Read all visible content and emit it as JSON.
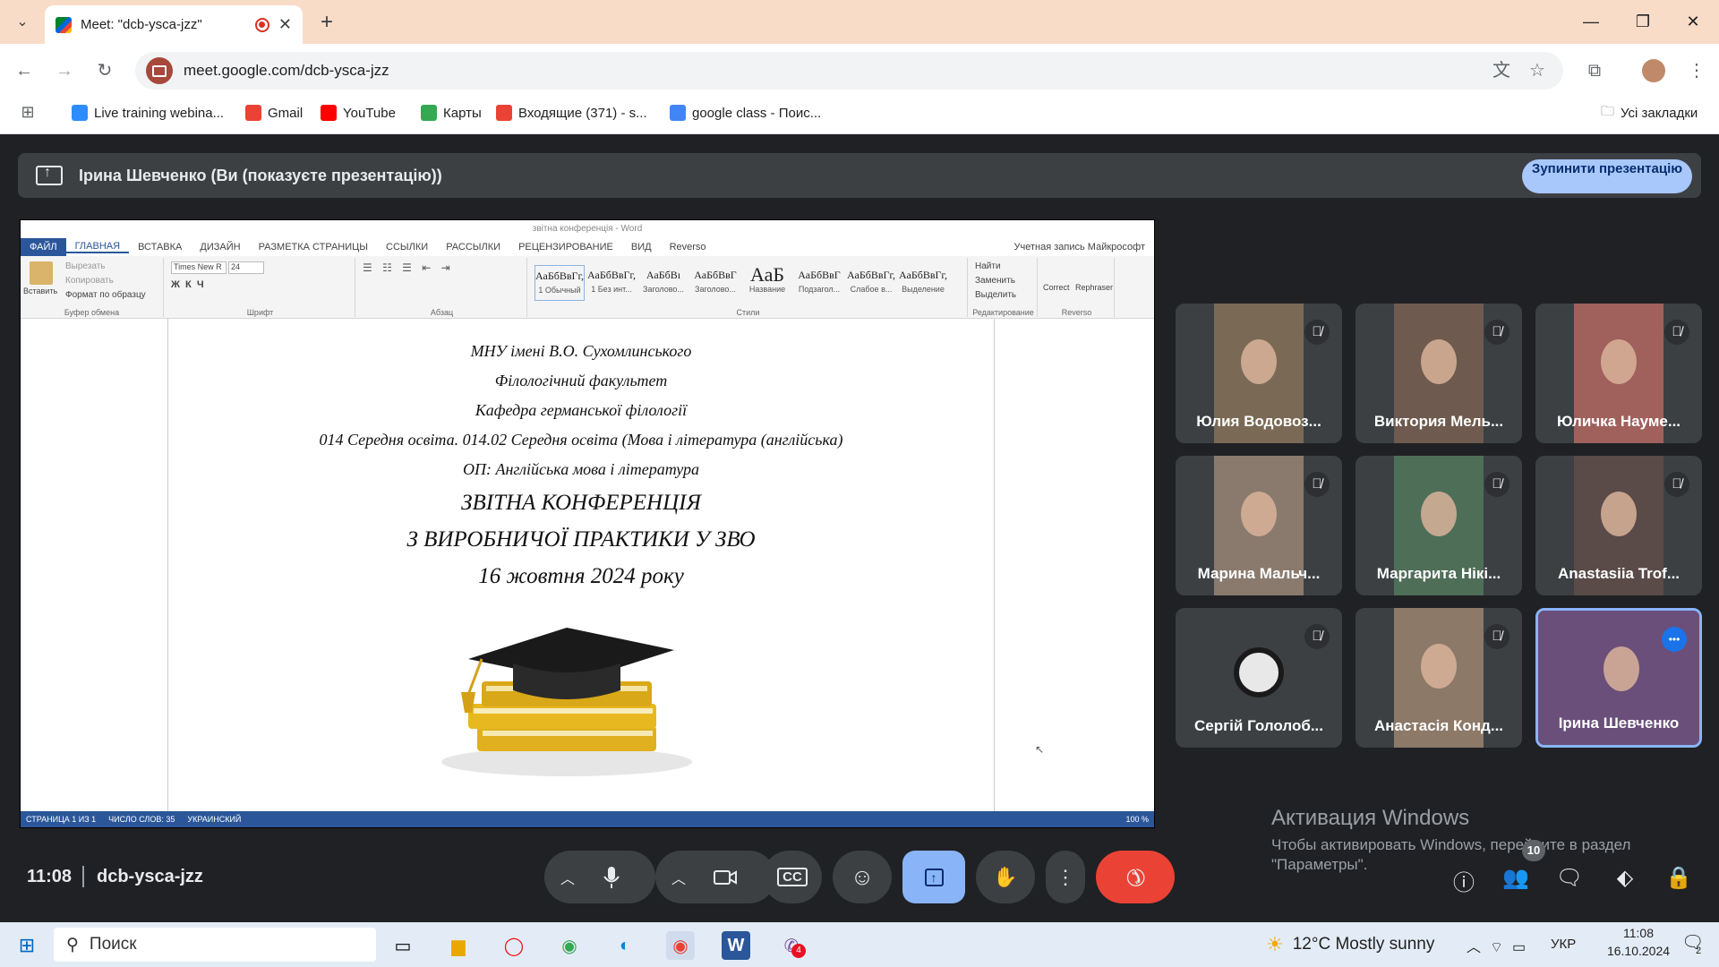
{
  "browser": {
    "tab_title": "Meet: \"dcb-ysca-jzz\"",
    "tab_close": "✕",
    "new_tab": "+",
    "url": "meet.google.com/dcb-ysca-jzz",
    "bookmarks": [
      {
        "label": "Live training webina...",
        "icon": "zoom-icon",
        "color": "#2d8cff"
      },
      {
        "label": "Gmail",
        "icon": "gmail-icon",
        "color": "#ea4335"
      },
      {
        "label": "YouTube",
        "icon": "youtube-icon",
        "color": "#ff0000"
      },
      {
        "label": "Карты",
        "icon": "maps-icon",
        "color": "#34a853"
      },
      {
        "label": "Входящие (371) - s...",
        "icon": "gmail-icon",
        "color": "#ea4335"
      },
      {
        "label": "google class - Поис...",
        "icon": "google-icon",
        "color": "#4285f4"
      }
    ],
    "all_bookmarks": "Усі закладки"
  },
  "presentation_bar": {
    "text": "Ірина Шевченко (Ви (показуєте презентацію))",
    "stop_button": "Зупинити презентацію"
  },
  "word": {
    "title": "звітна конференція - Word",
    "tabs": [
      "ФАЙЛ",
      "ГЛАВНАЯ",
      "ВСТАВКА",
      "ДИЗАЙН",
      "РАЗМЕТКА СТРАНИЦЫ",
      "ССЫЛКИ",
      "РАССЫЛКИ",
      "РЕЦЕНЗИРОВАНИЕ",
      "ВИД",
      "Reverso"
    ],
    "account": "Учетная запись Майкрософт",
    "clipboard": {
      "paste": "Вставить",
      "cut": "Вырезать",
      "copy": "Копировать",
      "format": "Формат по образцу",
      "label": "Буфер обмена"
    },
    "font": {
      "name": "Times New R",
      "size": "24",
      "label": "Шрифт"
    },
    "paragraph_label": "Абзац",
    "styles": [
      {
        "sample": "АаБбВвГг,",
        "name": "1 Обычный"
      },
      {
        "sample": "АаБбВвГг,",
        "name": "1 Без инт..."
      },
      {
        "sample": "АаБбВı",
        "name": "Заголово..."
      },
      {
        "sample": "АаБбВвГ",
        "name": "Заголово..."
      },
      {
        "sample": "АаБ",
        "name": "Название"
      },
      {
        "sample": "АаБбВвГ",
        "name": "Подзагол..."
      },
      {
        "sample": "АаБбВвГг,",
        "name": "Слабое в..."
      },
      {
        "sample": "АаБбВвГг,",
        "name": "Выделение"
      }
    ],
    "styles_label": "Стили",
    "editing": {
      "find": "Найти",
      "replace": "Заменить",
      "select": "Выделить",
      "label": "Редактирование"
    },
    "reverso": {
      "correct": "Correct",
      "rephrase": "Rephraser",
      "label": "Reverso"
    },
    "doc_lines": [
      "МНУ імені В.О. Сухомлинського",
      "Філологічний факультет",
      "Кафедра германської філології",
      "014 Середня освіта. 014.02 Середня освіта (Мова і література (англійська)",
      "ОП: Англійська мова і література"
    ],
    "doc_big": [
      "ЗВІТНА КОНФЕРЕНЦІЯ",
      "З ВИРОБНИЧОЇ ПРАКТИКИ У ЗВО",
      "16 жовтня 2024 року"
    ],
    "status": {
      "page": "СТРАНИЦА 1 ИЗ 1",
      "words": "ЧИСЛО СЛОВ: 35",
      "lang": "УКРАИНСКИЙ",
      "zoom": "100 %"
    }
  },
  "participants": [
    {
      "name": "Юлия Водовоз...",
      "muted": true,
      "bg": "#7a6a55"
    },
    {
      "name": "Виктория Мель...",
      "muted": true,
      "bg": "#6e5a4e"
    },
    {
      "name": "Юличка Науме...",
      "muted": true,
      "bg": "#a0605c"
    },
    {
      "name": "Марина Мальч...",
      "muted": true,
      "bg": "#8a7a6e"
    },
    {
      "name": "Маргарита Нікі...",
      "muted": true,
      "bg": "#4f6e58"
    },
    {
      "name": "Anastasiia Trof...",
      "muted": true,
      "bg": "#5a4a48"
    },
    {
      "name": "Сергій Гололоб...",
      "muted": true,
      "bg": "#3c4043"
    },
    {
      "name": "Анастасія Конд...",
      "muted": true,
      "bg": "#8c7968"
    },
    {
      "name": "Ірина Шевченко",
      "muted": false,
      "bg": "#6a4f7a"
    }
  ],
  "meeting": {
    "time": "11:08",
    "code": "dcb-ysca-jzz",
    "people_count": "10"
  },
  "activation": {
    "title": "Активация Windows",
    "line1": "Чтобы активировать Windows, перейдите в раздел",
    "line2": "\"Параметры\"."
  },
  "taskbar": {
    "search": "Поиск",
    "weather": "12°C  Mostly sunny",
    "lang": "УКР",
    "time": "11:08",
    "date": "16.10.2024",
    "notif_count": "2",
    "word_badge": "4"
  }
}
